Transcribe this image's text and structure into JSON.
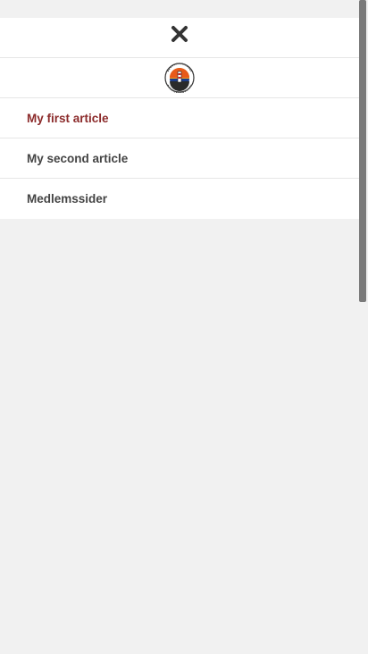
{
  "menu": {
    "close_icon": "close-icon",
    "logo_icon": "club-logo",
    "items": [
      {
        "label": "My first article",
        "active": true
      },
      {
        "label": "My second article",
        "active": false
      },
      {
        "label": "Medlemssider",
        "active": false
      }
    ]
  },
  "colors": {
    "active_link": "#8b2a2a",
    "link": "#444444",
    "background": "#f1f1f1",
    "panel": "#ffffff"
  }
}
